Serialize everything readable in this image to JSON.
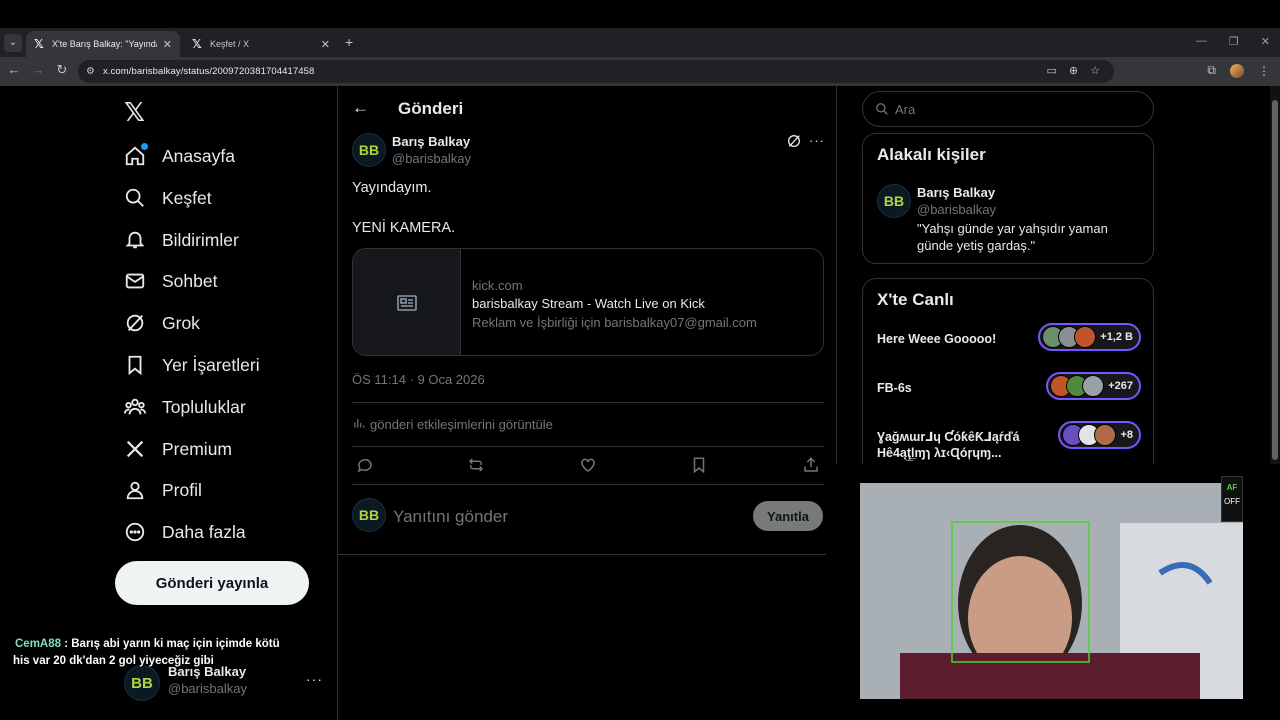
{
  "browser": {
    "tabs": [
      {
        "title": "X'te Barış Balkay: \"Yayındayım. Y",
        "active": true
      },
      {
        "title": "Keşfet / X",
        "active": false
      }
    ],
    "url": "x.com/barisbalkay/status/2009720381704417458"
  },
  "left_nav": {
    "items": [
      {
        "label": "Anasayfa",
        "icon": "home-icon"
      },
      {
        "label": "Keşfet",
        "icon": "search-icon"
      },
      {
        "label": "Bildirimler",
        "icon": "bell-icon"
      },
      {
        "label": "Sohbet",
        "icon": "mail-icon"
      },
      {
        "label": "Grok",
        "icon": "grok-icon"
      },
      {
        "label": "Yer İşaretleri",
        "icon": "bookmark-icon"
      },
      {
        "label": "Topluluklar",
        "icon": "communities-icon"
      },
      {
        "label": "Premium",
        "icon": "x-icon"
      },
      {
        "label": "Profil",
        "icon": "person-icon"
      },
      {
        "label": "Daha fazla",
        "icon": "more-circle-icon"
      }
    ],
    "post_button": "Gönderi yayınla",
    "me": {
      "name": "Barış Balkay",
      "handle": "@barisbalkay",
      "more": "···"
    }
  },
  "chat_overlay": {
    "user": "CemA88",
    "message": " : Barış abi yarın ki maç için içimde kötü his var 20 dk'dan 2 gol yiyeceğiz gibi"
  },
  "main": {
    "title": "Gönderi",
    "tweet": {
      "name": "Barış Balkay",
      "handle": "@barisbalkay",
      "avatar_text": "BB",
      "line1": "Yayındayım.",
      "line2": "YENİ KAMERA.",
      "card": {
        "domain": "kick.com",
        "title": "barisbalkay Stream - Watch Live on Kick",
        "description": "Reklam ve İşbirliği için barisbalkay07@gmail.com"
      },
      "meta": "ÖS 11:14 · 9 Oca 2026",
      "analytics": "gönderi etkileşimlerini görüntüle"
    },
    "reply": {
      "placeholder": "Yanıtını gönder",
      "button": "Yanıtla"
    }
  },
  "right": {
    "search_placeholder": "Ara",
    "related": {
      "title": "Alakalı kişiler",
      "name": "Barış Balkay",
      "handle": "@barisbalkay",
      "bio": "\"Yahşı günde yar yahşıdır yaman günde yetiş gardaş.\""
    },
    "live": {
      "title": "X'te Canlı",
      "items": [
        {
          "title": "Here Weee Gooooo!",
          "count": "+1,2 B"
        },
        {
          "title": "FB-6s",
          "count": "+267"
        },
        {
          "title": "Ɣağʍɯr⅃ɥ ƇóƙêƘ⅃ąŕďá Hê4ąţ̲l̲ɱɿ λɪ‹Ɋóŗɥɱ...",
          "count": "+8"
        }
      ]
    }
  },
  "webcam": {
    "af_label": "AF",
    "af_state": "OFF"
  }
}
